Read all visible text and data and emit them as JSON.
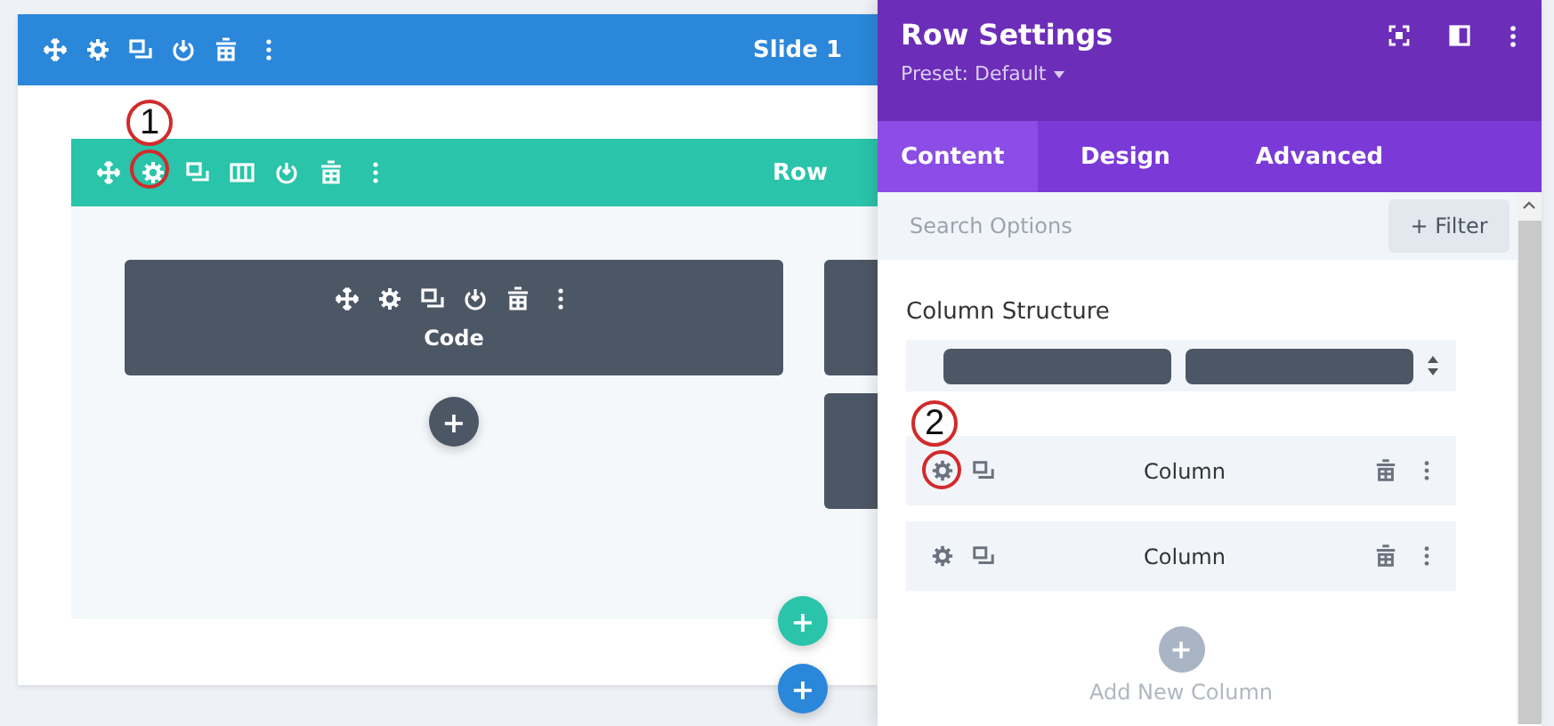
{
  "slide": {
    "title": "Slide 1"
  },
  "row": {
    "title": "Row",
    "annotation": "1"
  },
  "modules": [
    {
      "title": "Code"
    }
  ],
  "settings_panel": {
    "title": "Row Settings",
    "preset": "Preset: Default",
    "tabs": [
      {
        "label": "Content",
        "selected": true
      },
      {
        "label": "Design",
        "selected": false
      },
      {
        "label": "Advanced",
        "selected": false
      }
    ],
    "search": {
      "placeholder": "Search Options"
    },
    "filter_button": "+ Filter",
    "column_structure_label": "Column Structure",
    "columns": [
      {
        "label": "Column",
        "annotation": "2"
      },
      {
        "label": "Column"
      }
    ],
    "add_column": {
      "icon": "+",
      "label": "Add New Column"
    }
  },
  "add_buttons": [
    {
      "kind": "module",
      "label": "+"
    },
    {
      "kind": "row",
      "label": "+"
    },
    {
      "kind": "section",
      "label": "+"
    }
  ]
}
